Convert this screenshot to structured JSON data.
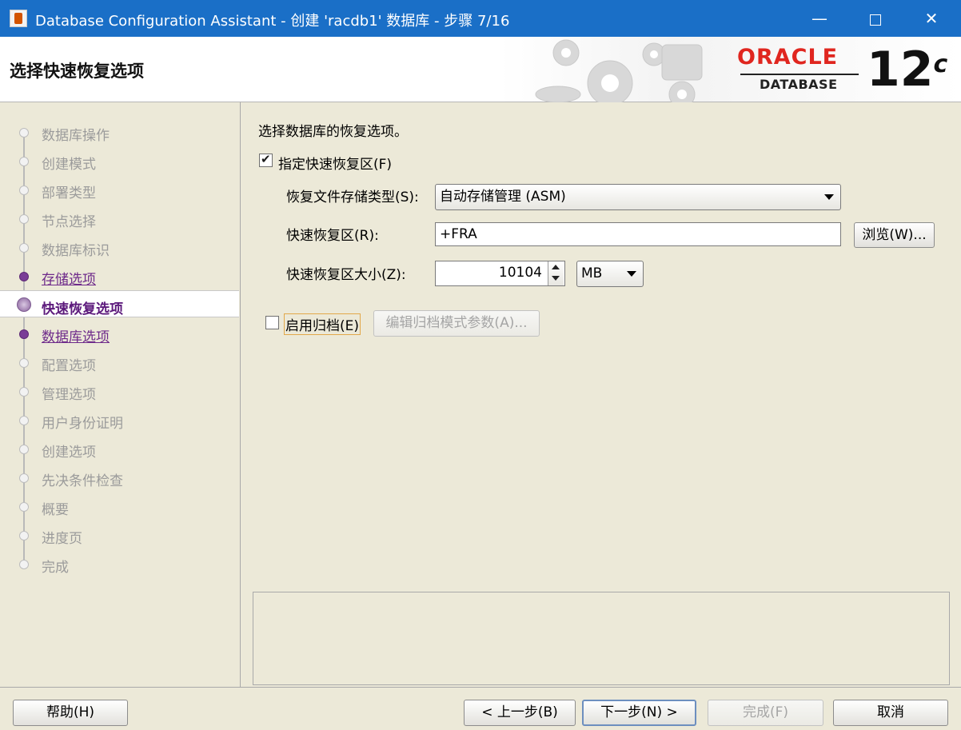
{
  "window": {
    "title": "Database Configuration Assistant - 创建 'racdb1' 数据库 - 步骤 7/16",
    "minimize_label": "—",
    "close_label": "✕"
  },
  "header": {
    "page_title": "选择快速恢复选项",
    "logo_brand": "ORACLE",
    "logo_product": "DATABASE",
    "version_major": "12",
    "version_suffix": "c"
  },
  "nav": {
    "items": [
      {
        "label": "数据库操作",
        "state": "pending"
      },
      {
        "label": "创建模式",
        "state": "pending"
      },
      {
        "label": "部署类型",
        "state": "pending"
      },
      {
        "label": "节点选择",
        "state": "pending"
      },
      {
        "label": "数据库标识",
        "state": "pending"
      },
      {
        "label": "存储选项",
        "state": "done"
      },
      {
        "label": "快速恢复选项",
        "state": "current"
      },
      {
        "label": "数据库选项",
        "state": "done"
      },
      {
        "label": "配置选项",
        "state": "pending"
      },
      {
        "label": "管理选项",
        "state": "pending"
      },
      {
        "label": "用户身份证明",
        "state": "pending"
      },
      {
        "label": "创建选项",
        "state": "pending"
      },
      {
        "label": "先决条件检查",
        "state": "pending"
      },
      {
        "label": "概要",
        "state": "pending"
      },
      {
        "label": "进度页",
        "state": "pending"
      },
      {
        "label": "完成",
        "state": "pending"
      }
    ]
  },
  "main": {
    "intro": "选择数据库的恢复选项。",
    "specify_fra": {
      "label": "指定快速恢复区(F)",
      "checked": true
    },
    "storage_type": {
      "label": "恢复文件存储类型(S):",
      "value": "自动存储管理 (ASM)"
    },
    "fra_location": {
      "label": "快速恢复区(R):",
      "value": "+FRA",
      "browse_label": "浏览(W)..."
    },
    "fra_size": {
      "label": "快速恢复区大小(Z):",
      "value": "10104",
      "unit": "MB"
    },
    "archiving": {
      "label": "启用归档(E)",
      "checked": false,
      "edit_params_label": "编辑归档模式参数(A)..."
    }
  },
  "footer": {
    "help": "帮助(H)",
    "back": "< 上一步(B)",
    "next": "下一步(N) >",
    "finish": "完成(F)",
    "cancel": "取消"
  },
  "colors": {
    "titlebar": "#1a6fc7",
    "oracle_red": "#e0261f",
    "nav_done": "#6e2a8a",
    "background": "#ece9d8"
  }
}
